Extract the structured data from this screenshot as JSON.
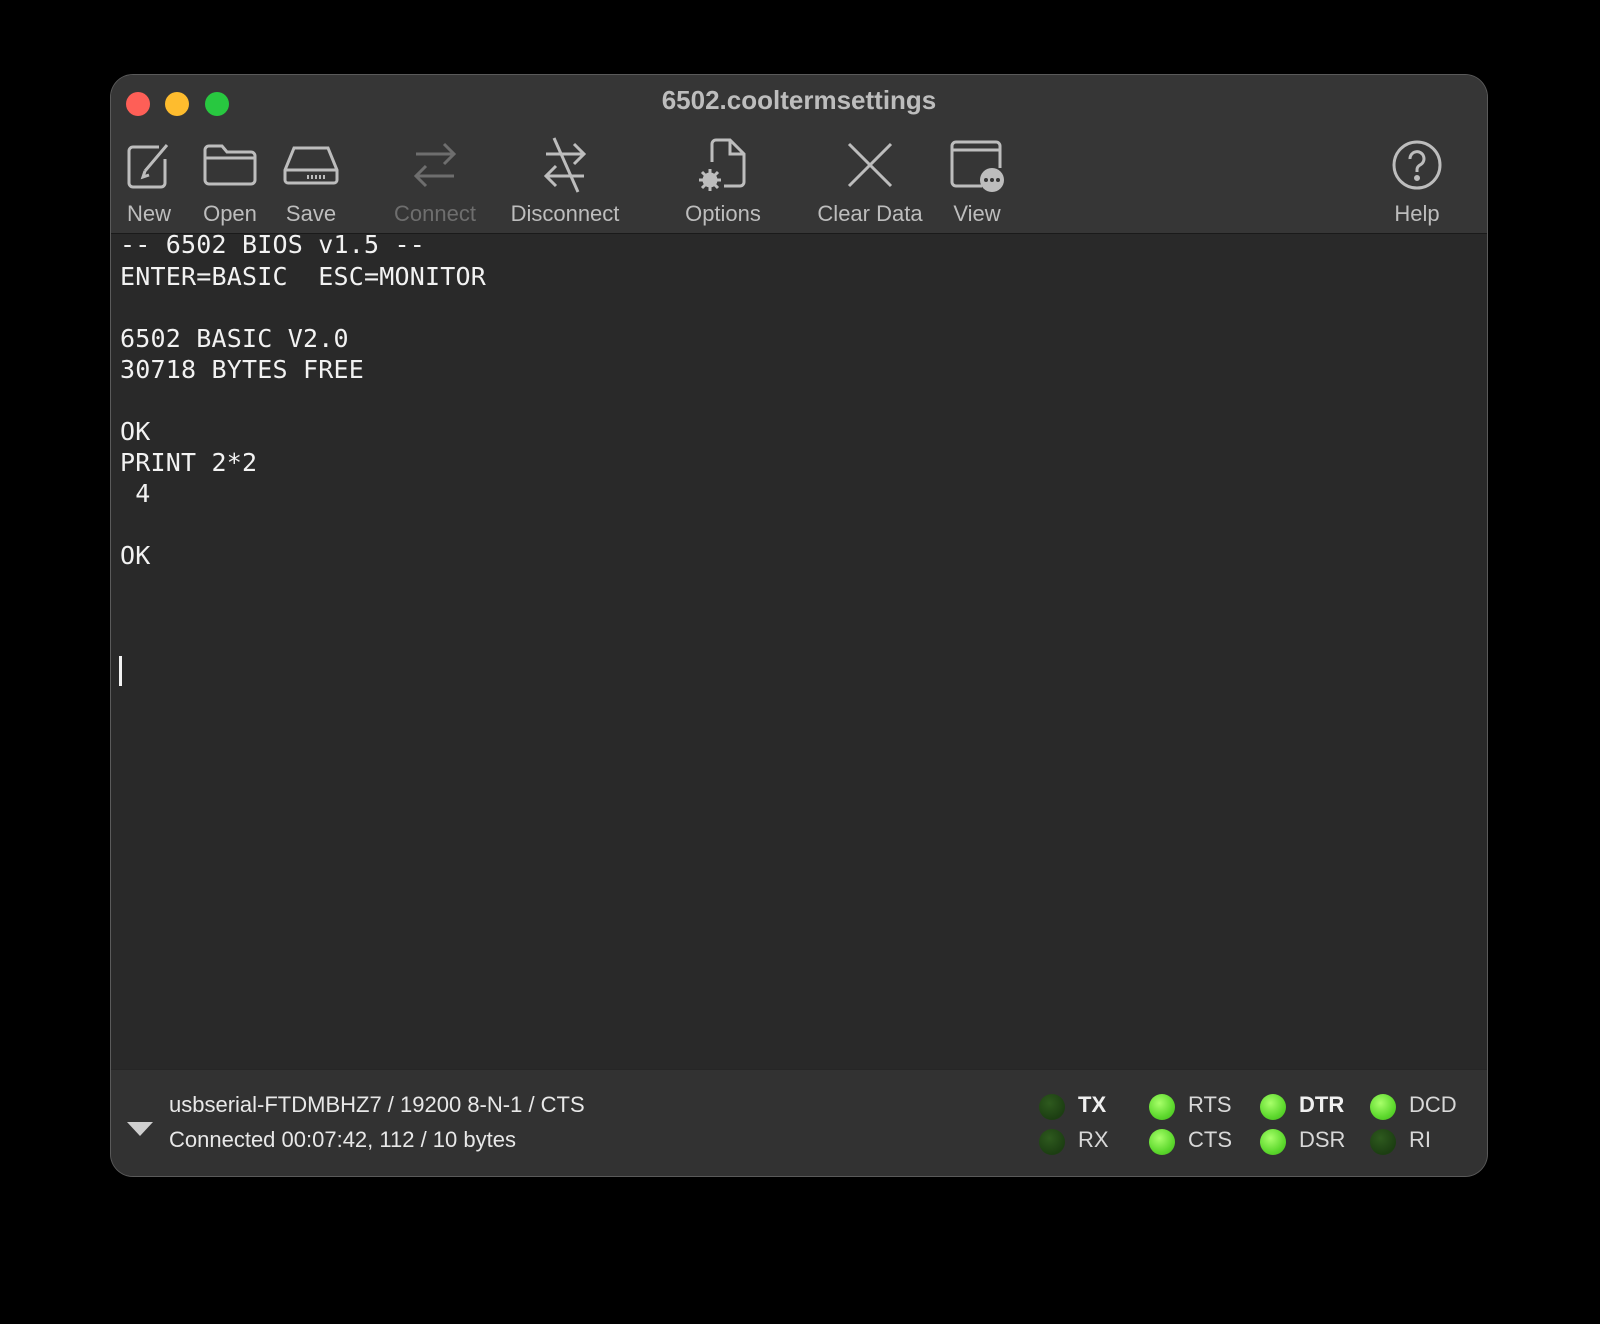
{
  "window": {
    "title": "6502.cooltermsettings"
  },
  "toolbar": {
    "new": "New",
    "open": "Open",
    "save": "Save",
    "connect": "Connect",
    "disconnect": "Disconnect",
    "options": "Options",
    "clear_data": "Clear Data",
    "view": "View",
    "help": "Help"
  },
  "terminal": {
    "lines": [
      "-- 6502 BIOS v1.5 --",
      "ENTER=BASIC  ESC=MONITOR",
      "",
      "6502 BASIC V2.0",
      "30718 BYTES FREE",
      "",
      "OK",
      "PRINT 2*2",
      " 4",
      "",
      "OK"
    ]
  },
  "status": {
    "port_info": "usbserial-FTDMBHZ7 / 19200 8-N-1 / CTS",
    "connection_info": "Connected 00:07:42, 112 / 10 bytes"
  },
  "signals": {
    "tx": {
      "label": "TX",
      "on": false
    },
    "rx": {
      "label": "RX",
      "on": false
    },
    "rts": {
      "label": "RTS",
      "on": true
    },
    "cts": {
      "label": "CTS",
      "on": true
    },
    "dtr": {
      "label": "DTR",
      "on": true
    },
    "dsr": {
      "label": "DSR",
      "on": true
    },
    "dcd": {
      "label": "DCD",
      "on": true
    },
    "ri": {
      "label": "RI",
      "on": false
    }
  }
}
